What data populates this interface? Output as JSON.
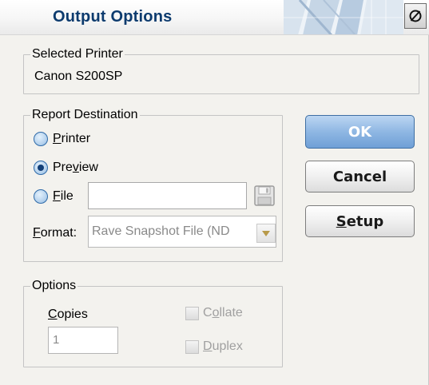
{
  "window": {
    "title": "Output Options"
  },
  "selected_printer": {
    "legend": "Selected Printer",
    "name": "Canon S200SP"
  },
  "report_destination": {
    "legend": "Report Destination",
    "options": [
      {
        "label_u": "P",
        "label_rest": "rinter",
        "selected": false
      },
      {
        "label_pre": "Pre",
        "label_u": "v",
        "label_rest": "iew",
        "selected": true
      },
      {
        "label_u": "F",
        "label_rest": "ile",
        "selected": false
      }
    ],
    "file_path": "",
    "format_label_u": "F",
    "format_label_rest": "ormat:",
    "format_value": "Rave Snapshot File (ND"
  },
  "buttons": {
    "ok": "OK",
    "cancel": "Cancel",
    "setup_u": "S",
    "setup_rest": "etup"
  },
  "options": {
    "legend": "Options",
    "copies_label_u": "C",
    "copies_label_rest": "opies",
    "copies_value": "1",
    "collate_pre": "C",
    "collate_u": "o",
    "collate_rest": "llate",
    "collate_checked": false,
    "duplex_u": "D",
    "duplex_rest": "uplex",
    "duplex_checked": false
  },
  "icons": {
    "close": "disabled-circle-icon",
    "save": "floppy-disk-icon",
    "dropdown": "triangle-down-icon"
  },
  "colors": {
    "title_text": "#0d3b6e",
    "ok_button": "#8fb7e3",
    "disabled_text": "#8a8a8a"
  }
}
